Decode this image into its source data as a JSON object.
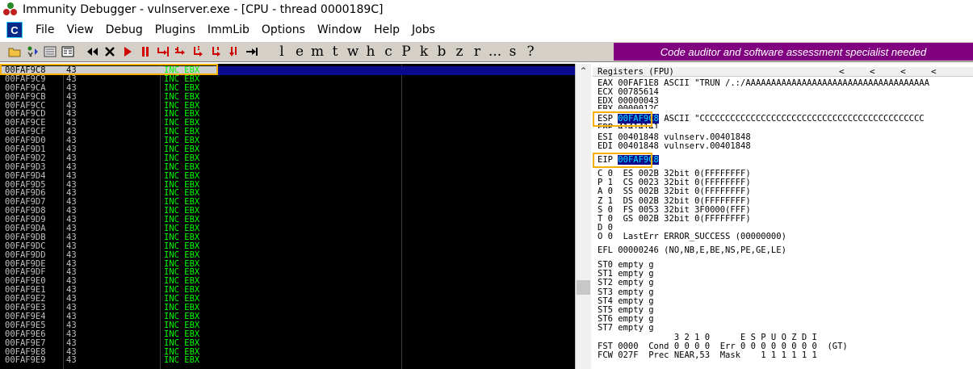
{
  "window": {
    "title": "Immunity Debugger - vulnserver.exe - [CPU - thread 0000189C]"
  },
  "menu": [
    "File",
    "View",
    "Debug",
    "Plugins",
    "ImmLib",
    "Options",
    "Window",
    "Help",
    "Jobs"
  ],
  "toolbar": {
    "letters": [
      "l",
      "e",
      "m",
      "t",
      "w",
      "h",
      "c",
      "P",
      "k",
      "b",
      "z",
      "r",
      "...",
      "s",
      "?"
    ],
    "banner": "Code auditor and software assessment specialist needed",
    "icons": [
      "open-icon",
      "restart-icon",
      "close-file-icon",
      "module-icon",
      "rewind-icon",
      "close-icon",
      "run-icon",
      "pause-icon",
      "step-into-icon",
      "step-over-icon",
      "trace-into-icon",
      "trace-over-icon",
      "execute-till-return-icon",
      "go-to-icon"
    ]
  },
  "disassembly": {
    "rows": [
      {
        "addr": "00FAF9C8",
        "hex": "43",
        "instr": "INC EBX",
        "selected": true
      },
      {
        "addr": "00FAF9C9",
        "hex": "43",
        "instr": "INC EBX"
      },
      {
        "addr": "00FAF9CA",
        "hex": "43",
        "instr": "INC EBX"
      },
      {
        "addr": "00FAF9CB",
        "hex": "43",
        "instr": "INC EBX"
      },
      {
        "addr": "00FAF9CC",
        "hex": "43",
        "instr": "INC EBX"
      },
      {
        "addr": "00FAF9CD",
        "hex": "43",
        "instr": "INC EBX"
      },
      {
        "addr": "00FAF9CE",
        "hex": "43",
        "instr": "INC EBX"
      },
      {
        "addr": "00FAF9CF",
        "hex": "43",
        "instr": "INC EBX"
      },
      {
        "addr": "00FAF9D0",
        "hex": "43",
        "instr": "INC EBX"
      },
      {
        "addr": "00FAF9D1",
        "hex": "43",
        "instr": "INC EBX"
      },
      {
        "addr": "00FAF9D2",
        "hex": "43",
        "instr": "INC EBX"
      },
      {
        "addr": "00FAF9D3",
        "hex": "43",
        "instr": "INC EBX"
      },
      {
        "addr": "00FAF9D4",
        "hex": "43",
        "instr": "INC EBX"
      },
      {
        "addr": "00FAF9D5",
        "hex": "43",
        "instr": "INC EBX"
      },
      {
        "addr": "00FAF9D6",
        "hex": "43",
        "instr": "INC EBX"
      },
      {
        "addr": "00FAF9D7",
        "hex": "43",
        "instr": "INC EBX"
      },
      {
        "addr": "00FAF9D8",
        "hex": "43",
        "instr": "INC EBX"
      },
      {
        "addr": "00FAF9D9",
        "hex": "43",
        "instr": "INC EBX"
      },
      {
        "addr": "00FAF9DA",
        "hex": "43",
        "instr": "INC EBX"
      },
      {
        "addr": "00FAF9DB",
        "hex": "43",
        "instr": "INC EBX"
      },
      {
        "addr": "00FAF9DC",
        "hex": "43",
        "instr": "INC EBX"
      },
      {
        "addr": "00FAF9DD",
        "hex": "43",
        "instr": "INC EBX"
      },
      {
        "addr": "00FAF9DE",
        "hex": "43",
        "instr": "INC EBX"
      },
      {
        "addr": "00FAF9DF",
        "hex": "43",
        "instr": "INC EBX"
      },
      {
        "addr": "00FAF9E0",
        "hex": "43",
        "instr": "INC EBX"
      },
      {
        "addr": "00FAF9E1",
        "hex": "43",
        "instr": "INC EBX"
      },
      {
        "addr": "00FAF9E2",
        "hex": "43",
        "instr": "INC EBX"
      },
      {
        "addr": "00FAF9E3",
        "hex": "43",
        "instr": "INC EBX"
      },
      {
        "addr": "00FAF9E4",
        "hex": "43",
        "instr": "INC EBX"
      },
      {
        "addr": "00FAF9E5",
        "hex": "43",
        "instr": "INC EBX"
      },
      {
        "addr": "00FAF9E6",
        "hex": "43",
        "instr": "INC EBX"
      },
      {
        "addr": "00FAF9E7",
        "hex": "43",
        "instr": "INC EBX"
      },
      {
        "addr": "00FAF9E8",
        "hex": "43",
        "instr": "INC EBX"
      },
      {
        "addr": "00FAF9E9",
        "hex": "43",
        "instr": "INC EBX"
      }
    ]
  },
  "registers": {
    "header": "Registers (FPU)",
    "nav": [
      "<",
      "<",
      "<",
      "<"
    ],
    "lines": [
      "EAX 00FAF1E8 ASCII \"TRUN /.:/AAAAAAAAAAAAAAAAAAAAAAAAAAAAAAAAAAAA",
      "ECX 00785614",
      "EDX 00000043",
      "EBX 0000012C"
    ],
    "esp": {
      "name": "ESP",
      "value": "00FAF9C8",
      "rest": "ASCII \"CCCCCCCCCCCCCCCCCCCCCCCCCCCCCCCCCCCCCCCCCCCC"
    },
    "after_esp": [
      "EBP 41414141",
      "ESI 00401848 vulnserv.00401848",
      "EDI 00401848 vulnserv.00401848"
    ],
    "eip": {
      "name": "EIP",
      "value": "00FAF9C8"
    },
    "flags": [
      "C 0  ES 002B 32bit 0(FFFFFFFF)",
      "P 1  CS 0023 32bit 0(FFFFFFFF)",
      "A 0  SS 002B 32bit 0(FFFFFFFF)",
      "Z 1  DS 002B 32bit 0(FFFFFFFF)",
      "S 0  FS 0053 32bit 3F0000(FFF)",
      "T 0  GS 002B 32bit 0(FFFFFFFF)",
      "D 0",
      "O 0  LastErr ERROR_SUCCESS (00000000)"
    ],
    "efl": "EFL 00000246 (NO,NB,E,BE,NS,PE,GE,LE)",
    "fpu": [
      "ST0 empty g",
      "ST1 empty g",
      "ST2 empty g",
      "ST3 empty g",
      "ST4 empty g",
      "ST5 empty g",
      "ST6 empty g",
      "ST7 empty g"
    ],
    "fpu_footer": [
      "               3 2 1 0      E S P U O Z D I",
      "FST 0000  Cond 0 0 0 0  Err 0 0 0 0 0 0 0 0  (GT)",
      "FCW 027F  Prec NEAR,53  Mask    1 1 1 1 1 1"
    ]
  },
  "colors": {
    "banner_bg": "#800080",
    "highlight_border": "#f5b000",
    "instr_green": "#00ff00",
    "selected_row": "#0a0a8c"
  }
}
